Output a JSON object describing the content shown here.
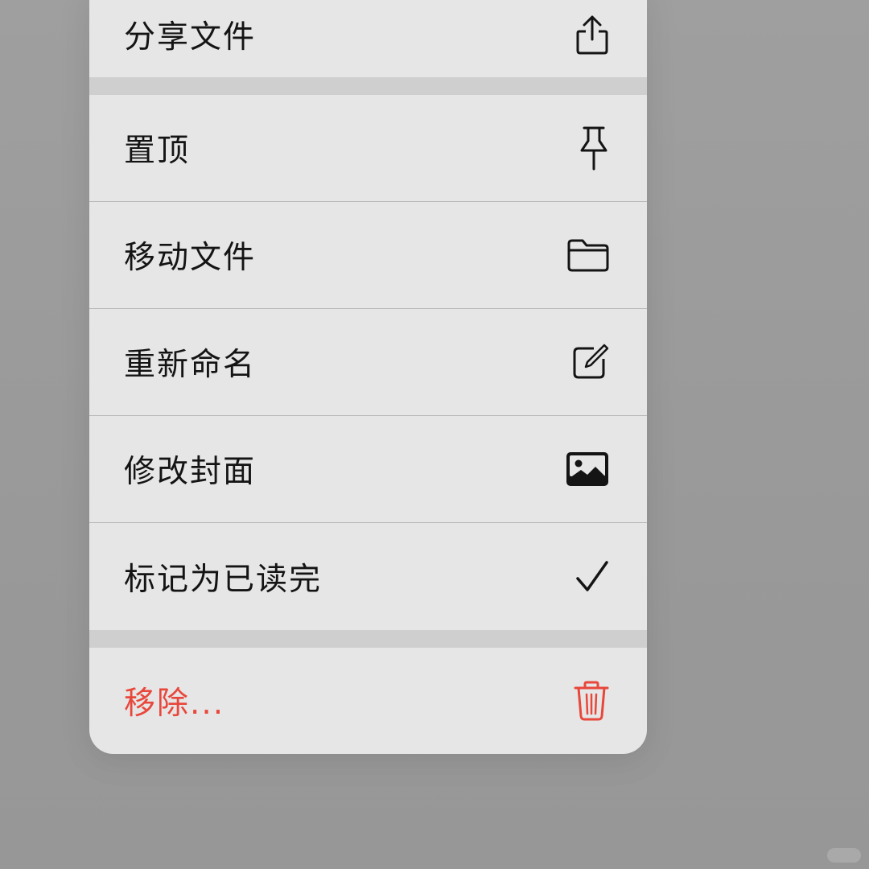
{
  "menu": {
    "items": [
      {
        "label": "分享文件",
        "icon": "share-icon"
      },
      {
        "label": "置顶",
        "icon": "pin-icon"
      },
      {
        "label": "移动文件",
        "icon": "folder-icon"
      },
      {
        "label": "重新命名",
        "icon": "edit-icon"
      },
      {
        "label": "修改封面",
        "icon": "image-icon"
      },
      {
        "label": "标记为已读完",
        "icon": "checkmark-icon"
      },
      {
        "label": "移除...",
        "icon": "trash-icon",
        "destructive": true
      }
    ]
  },
  "colors": {
    "backdrop": "#9b9b9b",
    "menu_background": "#e6e6e6",
    "group_separator": "#cfcfcf",
    "text": "#141414",
    "destructive": "#e8473b"
  }
}
